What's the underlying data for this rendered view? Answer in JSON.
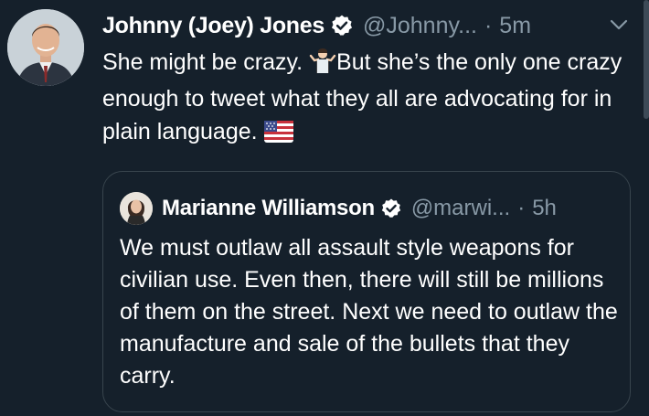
{
  "tweet": {
    "author_name": "Johnny (Joey) Jones",
    "author_handle": "@Johnny...",
    "separator": "·",
    "time": "5m",
    "text_part1": "She might be crazy. ",
    "text_part2": "But she’s the only one crazy enough to tweet what they all are advocating for in plain language. ",
    "emoji_shrug": "man-shrugging-emoji",
    "emoji_flag": "us-flag-emoji"
  },
  "quoted_tweet": {
    "author_name": "Marianne Williamson",
    "author_handle": "@marwi...",
    "separator": "·",
    "time": "5h",
    "text": "We must outlaw all assault style weapons for civilian use. Even then, there will still be millions of them on the street. Next we need to outlaw the manufacture and sale of the bullets that they carry."
  },
  "colors": {
    "background": "#15202b",
    "primary_text": "#ffffff",
    "secondary_text": "#8899a6",
    "border": "#38444d",
    "verified_badge": "#ffffff"
  }
}
